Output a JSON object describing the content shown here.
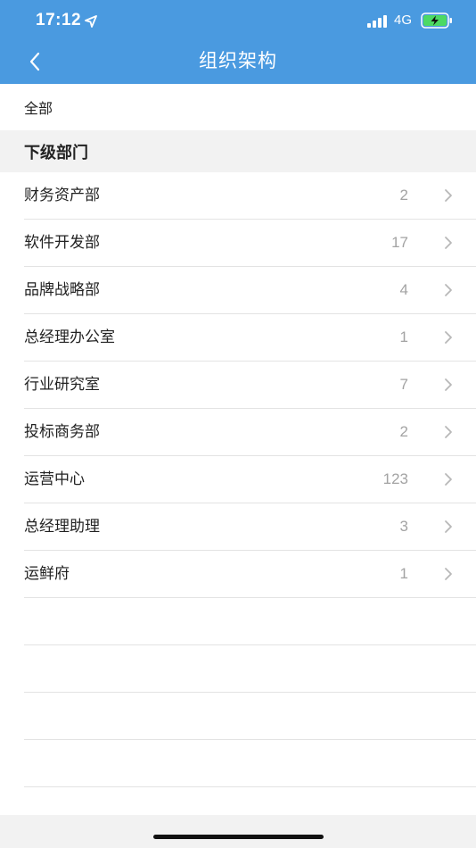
{
  "status_bar": {
    "time": "17:12",
    "network": "4G"
  },
  "nav": {
    "title": "组织架构",
    "back_icon": "chevron-left-icon"
  },
  "all_label": "全部",
  "section_title": "下级部门",
  "departments": [
    {
      "name": "财务资产部",
      "count": "2"
    },
    {
      "name": "软件开发部",
      "count": "17"
    },
    {
      "name": "品牌战略部",
      "count": "4"
    },
    {
      "name": "总经理办公室",
      "count": "1"
    },
    {
      "name": "行业研究室",
      "count": "7"
    },
    {
      "name": "投标商务部",
      "count": "2"
    },
    {
      "name": "运营中心",
      "count": "123"
    },
    {
      "name": "总经理助理",
      "count": "3"
    },
    {
      "name": "运鲜府",
      "count": "1"
    }
  ],
  "colors": {
    "header": "#4a9ae0",
    "battery_fill": "#4cd964",
    "section_bg": "#f2f2f2"
  }
}
